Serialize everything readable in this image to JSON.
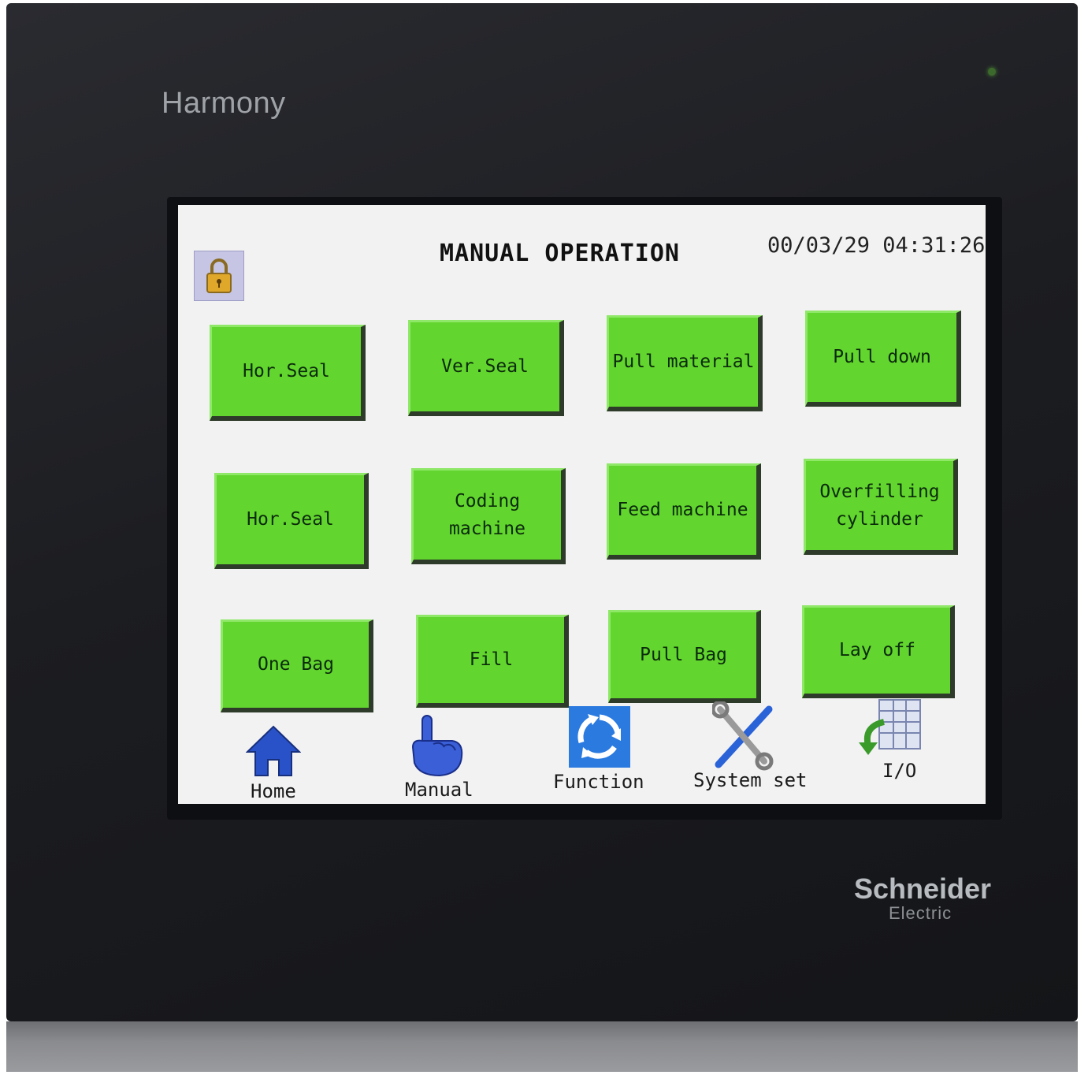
{
  "device": {
    "brand_top": "Harmony",
    "maker": "Schneider",
    "maker_sub": "Electric"
  },
  "header": {
    "title": "MANUAL OPERATION",
    "datetime": "00/03/29 04:31:26"
  },
  "buttons": [
    {
      "id": "hor-seal-1",
      "label": "Hor.Seal"
    },
    {
      "id": "ver-seal",
      "label": "Ver.Seal"
    },
    {
      "id": "pull-material",
      "label": "Pull material"
    },
    {
      "id": "pull-down",
      "label": "Pull down"
    },
    {
      "id": "hor-seal-2",
      "label": "Hor.Seal"
    },
    {
      "id": "coding-machine",
      "label": "Coding\nmachine"
    },
    {
      "id": "feed-machine",
      "label": "Feed machine"
    },
    {
      "id": "overfilling-cylinder",
      "label": "Overfilling\ncylinder"
    },
    {
      "id": "one-bag",
      "label": "One Bag"
    },
    {
      "id": "fill",
      "label": "Fill"
    },
    {
      "id": "pull-bag",
      "label": "Pull Bag"
    },
    {
      "id": "lay-off",
      "label": "Lay off"
    }
  ],
  "nav": [
    {
      "label": "Home",
      "icon": "home-icon"
    },
    {
      "label": "Manual",
      "icon": "hand-pointer-icon"
    },
    {
      "label": "Function",
      "icon": "recycle-arrows-icon"
    },
    {
      "label": "System set",
      "icon": "tools-icon"
    },
    {
      "label": "I/O",
      "icon": "io-table-arrow-icon"
    }
  ],
  "colors": {
    "button_green": "#62d62e",
    "screen_bg": "#f2f2f2",
    "nav_blue": "#2a52c8"
  }
}
